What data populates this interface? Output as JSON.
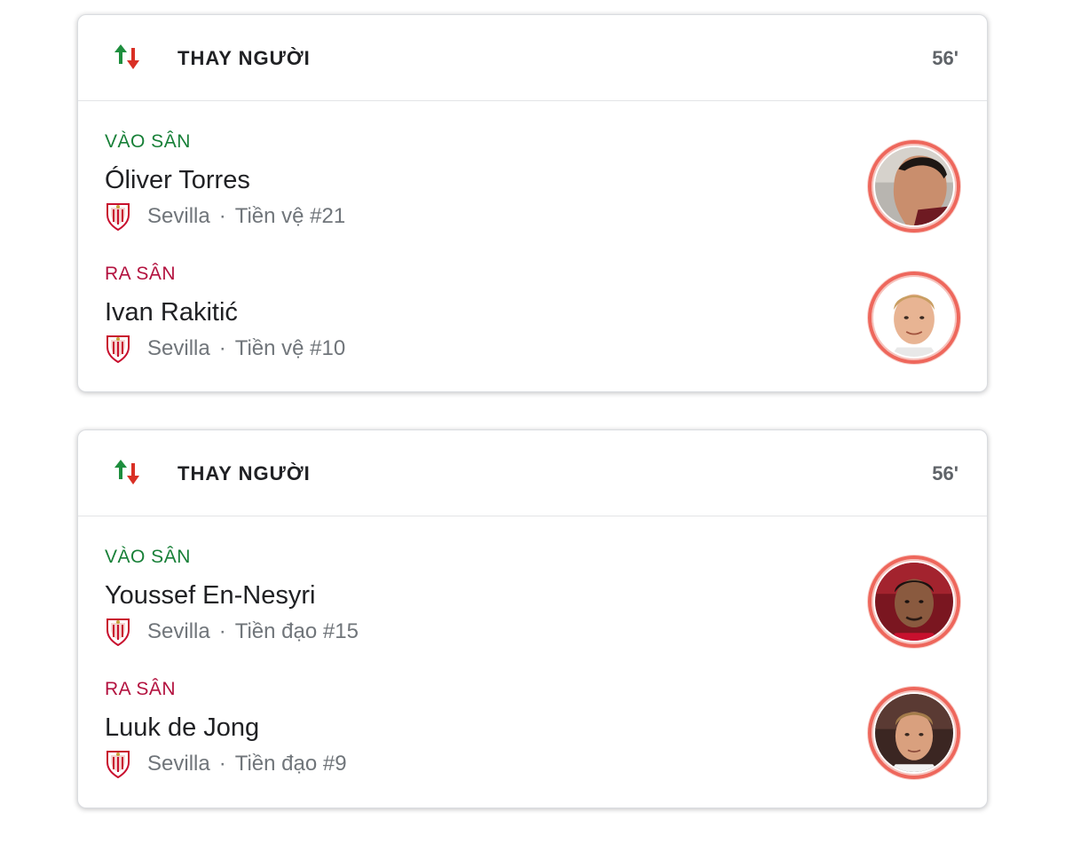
{
  "cards": [
    {
      "title": "THAY NGƯỜI",
      "minute": "56'",
      "in": {
        "direction": "VÀO SÂN",
        "name": "Óliver Torres",
        "team": "Sevilla",
        "separator": "·",
        "position": "Tiền vệ #21"
      },
      "out": {
        "direction": "RA SÂN",
        "name": "Ivan Rakitić",
        "team": "Sevilla",
        "separator": "·",
        "position": "Tiền vệ #10"
      }
    },
    {
      "title": "THAY NGƯỜI",
      "minute": "56'",
      "in": {
        "direction": "VÀO SÂN",
        "name": "Youssef En-Nesyri",
        "team": "Sevilla",
        "separator": "·",
        "position": "Tiền đạo #15"
      },
      "out": {
        "direction": "RA SÂN",
        "name": "Luuk de Jong",
        "team": "Sevilla",
        "separator": "·",
        "position": "Tiền đạo #9"
      }
    }
  ],
  "icons": {
    "substitution": "substitution-arrows-icon",
    "crest": "sevilla-crest-icon",
    "avatar": "player-photo"
  },
  "colors": {
    "in": "#188038",
    "out": "#b3123f",
    "arrow_up": "#1e8e3e",
    "arrow_down": "#d93025",
    "avatar_ring": "#ee675c"
  }
}
